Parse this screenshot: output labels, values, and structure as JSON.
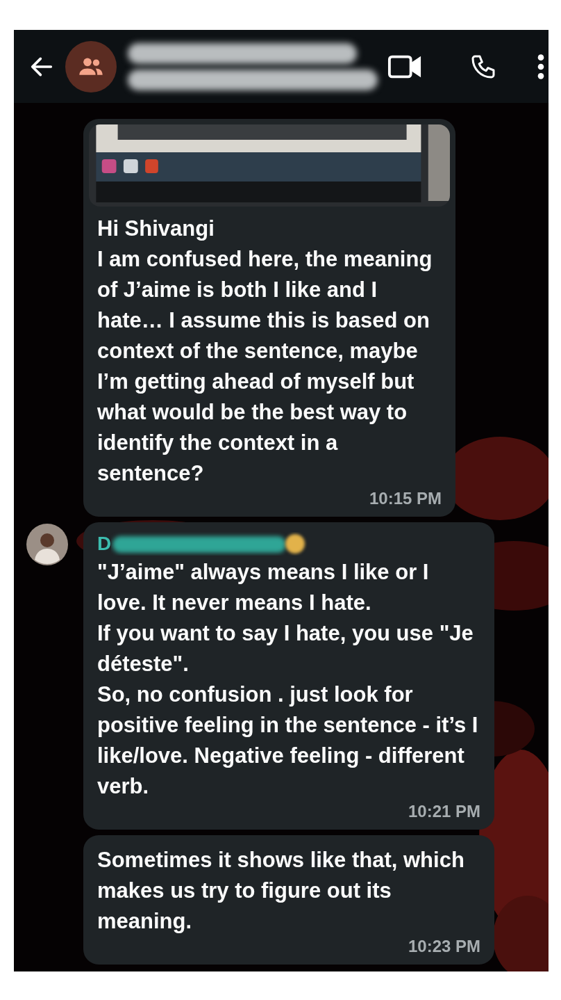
{
  "messages": [
    {
      "kind": "sent",
      "text": "Hi Shivangi\nI am confused here, the meaning of J’aime is both I like and I hate… I assume this is based on context of the sentence, maybe I’m getting ahead of myself but what would be the best way to identify the context in a sentence?",
      "time": "10:15 PM"
    },
    {
      "kind": "received",
      "sender": "D",
      "text": "\"J’aime\" always means I like or I love. It never means I hate.\nIf you want to say I hate, you use \"Je déteste\".\nSo, no confusion . just look for positive feeling in the sentence - it’s I like/love. Negative feeling - different verb.",
      "time": "10:21 PM"
    },
    {
      "kind": "received",
      "text": "Sometimes it shows like that, which makes us try to figure out its meaning.",
      "time": "10:23 PM"
    }
  ]
}
